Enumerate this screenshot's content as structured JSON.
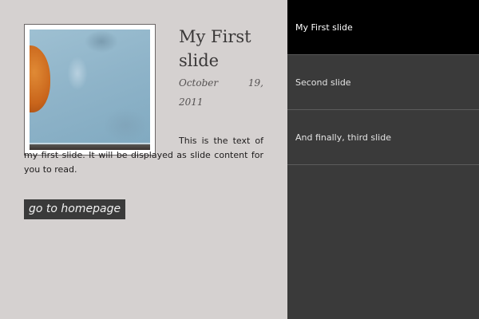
{
  "slide": {
    "title": "My First slide",
    "date_line1": "October 19,",
    "date_line2": "2011",
    "text": "This is the text of my first slide. It will be displayed as slide content for you to read.",
    "home_button_label": "go to homepage"
  },
  "sidebar": {
    "items": [
      {
        "label": "My First slide",
        "active": true
      },
      {
        "label": "Second slide",
        "active": false
      },
      {
        "label": "And finally, third slide",
        "active": false
      }
    ]
  },
  "colors": {
    "page_background": "#d5d1d0",
    "sidebar_background": "#3a3a3a",
    "active_item_background": "#000000"
  }
}
